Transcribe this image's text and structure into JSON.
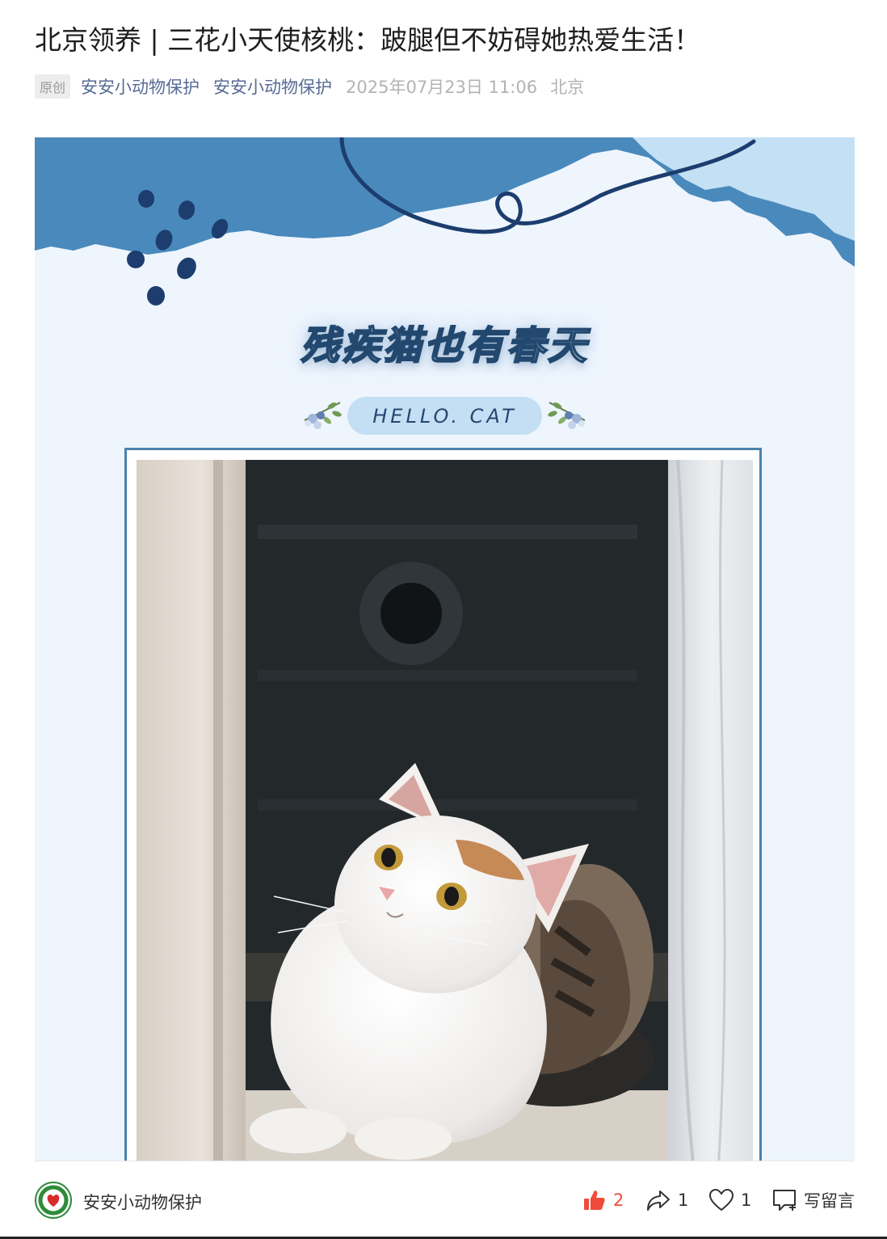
{
  "article": {
    "title": "北京领养 | 三花小天使核桃：跛腿但不妨碍她热爱生活！",
    "original_tag": "原创",
    "author": "安安小动物保护",
    "account": "安安小动物保护",
    "datetime": "2025年07月23日 11:06",
    "location": "北京"
  },
  "banner": {
    "headline": "残疾猫也有春天",
    "hello_label": "HELLO. CAT",
    "colors": {
      "sky": "#4a89bb",
      "light_sky": "#c3e0f5",
      "ink": "#1c3d6e",
      "bg": "#eef5fd"
    }
  },
  "bottom_bar": {
    "account_name": "安安小动物保护",
    "like_count": "2",
    "share_count": "1",
    "favorite_count": "1",
    "comment_label": "写留言",
    "icons": [
      "thumbs-up-icon",
      "share-icon",
      "heart-icon",
      "comment-icon"
    ]
  }
}
